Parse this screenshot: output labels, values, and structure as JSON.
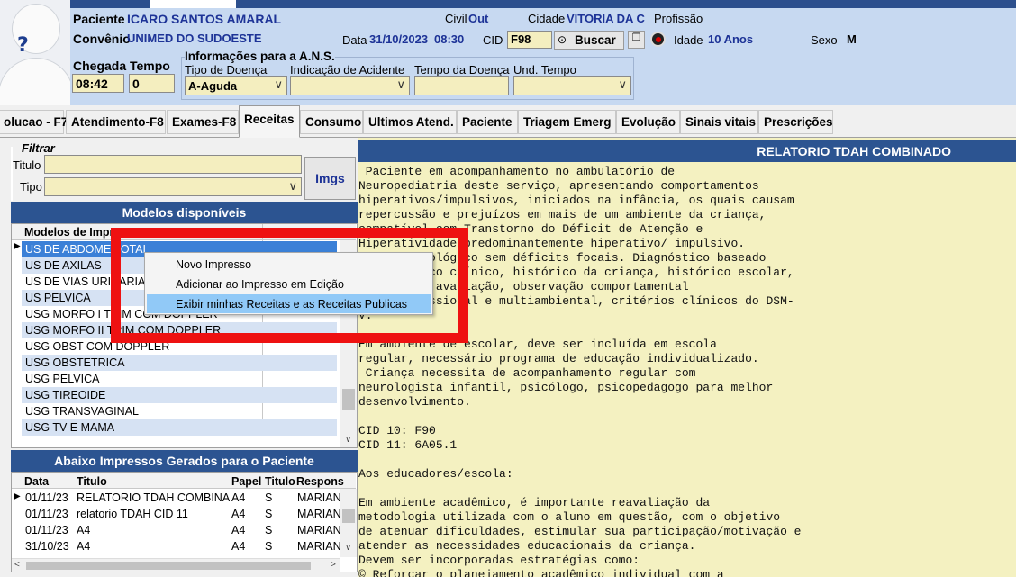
{
  "header": {
    "patient_label": "Paciente",
    "patient_name": "ICARO SANTOS AMARAL",
    "civil_label": "Civil",
    "civil_value": "Out",
    "city_label": "Cidade",
    "city_value": "VITORIA DA C",
    "profession_label": "Profissão",
    "insurance_label": "Convênio",
    "insurance_value": "UNIMED DO SUDOESTE",
    "date_label": "Data",
    "date_value": "31/10/2023",
    "time_value": "08:30",
    "cid_label": "CID",
    "cid_value": "F98",
    "search_button": "Buscar",
    "age_label": "Idade",
    "age_value": "10 Anos",
    "sex_label": "Sexo",
    "sex_value": "M",
    "arrival_label": "Chegada",
    "arrival_value": "08:42",
    "wait_label": "Tempo",
    "wait_value": "0",
    "ans_title": "Informações para a A.N.S.",
    "disease_type_label": "Tipo de Doença",
    "disease_type_value": "A-Aguda",
    "accident_label": "Indicação de Acidente",
    "accident_value": "",
    "disease_time_label": "Tempo da Doença",
    "disease_time_value": "",
    "time_unit_label": "Und. Tempo",
    "time_unit_value": ""
  },
  "tabs": [
    {
      "label": "olucao - F7"
    },
    {
      "label": "Atendimento-F8"
    },
    {
      "label": "Exames-F8"
    },
    {
      "label": "Receitas"
    },
    {
      "label": "Consumo"
    },
    {
      "label": "Ultimos Atend."
    },
    {
      "label": "Paciente"
    },
    {
      "label": "Triagem Emerg"
    },
    {
      "label": "Evolução"
    },
    {
      "label": "Sinais vitais"
    },
    {
      "label": "Prescrições"
    }
  ],
  "filter": {
    "title": "Filtrar",
    "title_label": "Titulo",
    "title_value": "",
    "type_label": "Tipo",
    "type_value": "",
    "imgs_button": "Imgs"
  },
  "models": {
    "title": "Modelos disponíveis",
    "column_header": "Modelos de Impr",
    "rows": [
      "US DE ABDOME TOTAL",
      "US DE AXILAS",
      "US DE VIAS URINARIAS",
      "US PELVICA",
      "USG MORFO I TRIM COM DOPPLER",
      "USG MORFO II TRIM COM DOPPLER",
      "USG OBST COM DOPPLER",
      "USG OBSTETRICA",
      "USG PELVICA",
      "USG TIREOIDE",
      "USG TRANSVAGINAL",
      "USG TV E MAMA"
    ]
  },
  "generated": {
    "title": "Abaixo Impressos Gerados para o Paciente",
    "columns": [
      "Data",
      "Titulo",
      "Papel",
      "Titulo",
      "Respons"
    ],
    "rows": [
      [
        "01/11/23",
        "RELATORIO TDAH COMBINAD",
        "A4",
        "S",
        "MARIANA"
      ],
      [
        "01/11/23",
        "relatorio TDAH CID 11",
        "A4",
        "S",
        "MARIANA"
      ],
      [
        "01/11/23",
        "A4",
        "A4",
        "S",
        "MARIANA"
      ],
      [
        "31/10/23",
        "A4",
        "A4",
        "S",
        "MARIANA"
      ]
    ]
  },
  "context_menu": {
    "items": [
      "Novo Impresso",
      "Adicionar ao Impresso em Edição",
      "Exibir minhas Receitas e as Receitas Publicas"
    ],
    "highlighted_index": 2
  },
  "report": {
    "title": "RELATORIO TDAH COMBINADO",
    "lines": [
      " Paciente em acompanhamento no ambulatório de",
      "Neuropediatria deste serviço, apresentando comportamentos",
      "hiperativos/impulsivos, iniciados na infância, os quais causam",
      "repercussão e prejuízos em mais de um ambiente da criança,",
      "compatível com Transtorno do Déficit de Atenção e",
      "Hiperatividade predominantemente hiperativo/ impulsivo.",
      "Exame neurológico sem déficits focais. Diagnóstico baseado",
      "em histórico clínico, histórico da criança, histórico escolar,",
      "avaliação, avaliação, observação comportamental",
      "multiprofissional e multiambiental, critérios clínicos do DSM-",
      "V.",
      "",
      "Em ambiente de escolar, deve ser incluída em escola",
      "regular, necessário programa de educação individualizado.",
      " Criança necessita de acompanhamento regular com",
      "neurologista infantil, psicólogo, psicopedagogo para melhor",
      "desenvolvimento.",
      "",
      "CID 10: F90",
      "CID 11: 6A05.1",
      "",
      "Aos educadores/escola:",
      "",
      "Em ambiente acadêmico, é importante reavaliação da",
      "metodologia utilizada com o aluno em questão, com o objetivo",
      "de atenuar dificuldades, estimular sua participação/motivação e",
      "atender as necessidades educacionais da criança.",
      "Devem ser incorporadas estratégias como:",
      "© Reforçar o planejamento acadêmico individual com a"
    ]
  },
  "colors": {
    "header_bg": "#c7d9f1",
    "title_bar": "#2c5491",
    "report_bg": "#f4f1c1",
    "field_bg": "#f4eebf",
    "selection": "#3b80d7",
    "highlight_box": "#ee1111"
  }
}
